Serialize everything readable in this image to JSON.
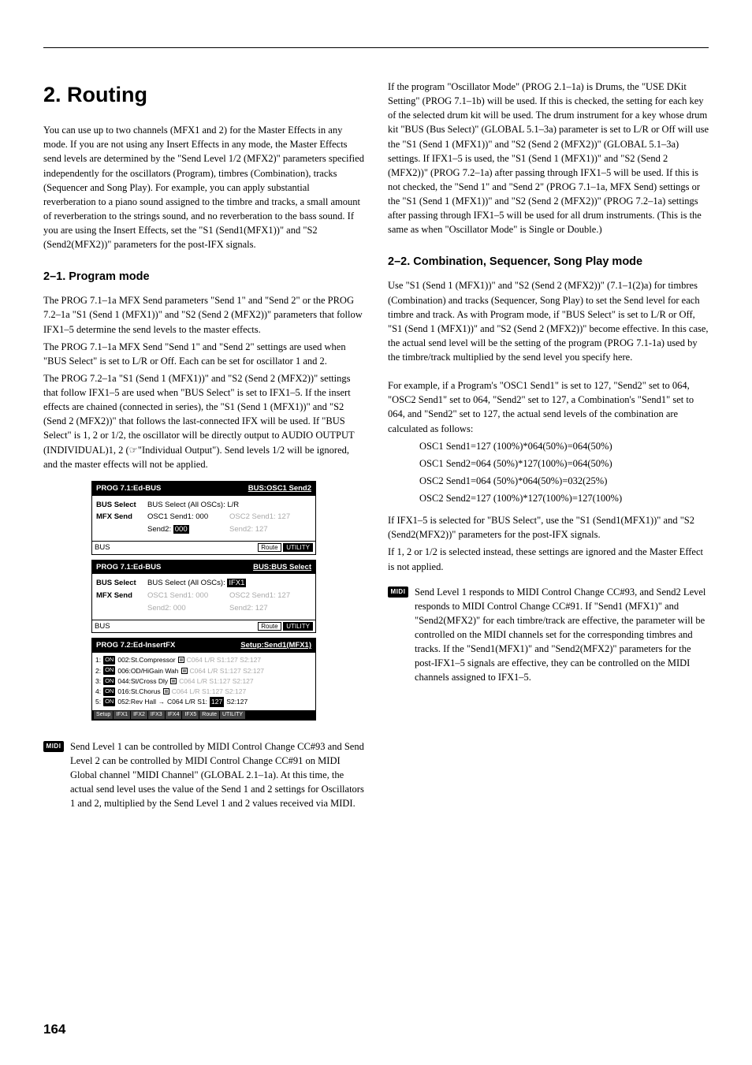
{
  "pageNumber": "164",
  "heading": "2. Routing",
  "intro": "You can use up to two channels (MFX1 and 2) for the Master Effects in any mode. If you are not using any Insert Effects in any mode, the Master Effects send levels are determined by the \"Send Level 1/2 (MFX2)\" parameters specified independently for the oscillators (Program), timbres (Combination), tracks (Sequencer and Song Play). For example, you can apply substantial reverberation to a piano sound assigned to the timbre and tracks, a small amount of reverberation to the strings sound, and no reverberation to the bass sound. If you are using the Insert Effects, set the \"S1 (Send1(MFX1))\" and \"S2 (Send2(MFX2))\" parameters for the post-IFX signals.",
  "sec21": {
    "title": "2–1. Program mode",
    "p1": "The PROG 7.1–1a MFX Send parameters \"Send 1\" and \"Send 2\" or the PROG 7.2–1a \"S1 (Send 1 (MFX1))\" and \"S2 (Send 2 (MFX2))\" parameters that follow IFX1–5 determine the send levels to the master effects.",
    "p2": "The PROG 7.1–1a MFX Send \"Send 1\" and \"Send 2\" settings are used when \"BUS Select\" is set to L/R or Off. Each can be set for oscillator 1 and 2.",
    "p3": "The PROG 7.2–1a \"S1 (Send 1 (MFX1))\" and \"S2 (Send 2 (MFX2))\" settings that follow IFX1–5 are used when \"BUS Select\" is set to IFX1–5. If the insert effects are chained (connected in series), the \"S1 (Send 1 (MFX1))\" and \"S2 (Send 2 (MFX2))\" that follows the last-connected IFX will be used. If \"BUS Select\" is 1, 2 or 1/2, the oscillator will be directly output to AUDIO OUTPUT (INDIVIDUAL)1, 2 (☞\"Individual Output\"). Send levels 1/2 will be ignored, and the master effects will not be applied."
  },
  "lcd1": {
    "title_l": "PROG 7.1:Ed-BUS",
    "title_r": "BUS:OSC1 Send2",
    "bus_select_lbl": "BUS Select",
    "bus_select_val": "BUS Select (All OSCs): L/R",
    "mfx_lbl": "MFX Send",
    "osc1send1": "OSC1 Send1: 000",
    "osc2send1": "OSC2 Send1: 127",
    "send2": "Send2:",
    "send2_val": "000",
    "send2_r": "Send2: 127",
    "bus_tab": "BUS",
    "route": "Route",
    "utility": "UTILITY"
  },
  "lcd2": {
    "title_l": "PROG 7.1:Ed-BUS",
    "title_r": "BUS:BUS Select",
    "bus_select_val": "BUS Select (All OSCs):",
    "bus_sel_hl": "IFX1",
    "osc1send1": "OSC1 Send1: 000",
    "osc2send1": "OSC2 Send1: 127",
    "send2": "Send2: 000",
    "send2_r": "Send2: 127"
  },
  "lcd3": {
    "title_l": "PROG 7.2:Ed-InsertFX",
    "title_r": "Setup:Send1(MFX1)",
    "r1a": "002:St.Compressor",
    "r1b": "C064 L/R S1:127 S2:127",
    "r2a": "006:OD/HiGain Wah",
    "r2b": "C064 L/R S1:127 S2:127",
    "r3a": "044:St/Cross Dly",
    "r3b": "C064 L/R S1:127 S2:127",
    "r4a": "016:St.Chorus",
    "r4b": "C064 L/R S1:127 S2:127",
    "r5a": "052:Rev Hall",
    "r5b1": "C064 L/R S1:",
    "r5b_hl": "127",
    "r5b2": "S2:127",
    "tabs": [
      "Setup",
      "IFX1",
      "IFX2",
      "IFX3",
      "IFX4",
      "IFX5",
      "Route",
      "UTILITY"
    ]
  },
  "midiLeft": {
    "icon": "MIDI",
    "text": "Send Level 1 can be controlled by MIDI Control Change CC#93 and Send Level 2 can be controlled by MIDI Control Change CC#91 on MIDI Global channel \"MIDI Channel\" (GLOBAL 2.1–1a). At this time, the actual send level uses the value of the Send 1 and 2 settings for Oscillators 1 and 2, multiplied by the Send Level 1 and 2 values received via MIDI."
  },
  "rightTop": "If the program \"Oscillator Mode\" (PROG 2.1–1a) is Drums, the \"USE DKit Setting\" (PROG 7.1–1b) will be used. If this is checked, the setting for each key of the selected drum kit will be used. The drum instrument for a key whose drum kit \"BUS (Bus Select)\" (GLOBAL 5.1–3a) parameter is set to L/R or Off will use the \"S1 (Send 1 (MFX1))\" and \"S2 (Send 2 (MFX2))\" (GLOBAL 5.1–3a) settings. If IFX1–5 is used, the \"S1 (Send 1 (MFX1))\" and \"S2 (Send 2 (MFX2))\" (PROG 7.2–1a) after passing through IFX1–5 will be used. If this is not checked, the \"Send 1\" and \"Send 2\" (PROG 7.1–1a, MFX Send) settings or the \"S1 (Send 1 (MFX1))\" and \"S2 (Send 2 (MFX2))\" (PROG 7.2–1a) settings after passing through IFX1–5 will be used for all drum instruments. (This is the same as when \"Oscillator Mode\" is Single or Double.)",
  "sec22": {
    "title": "2–2. Combination, Sequencer, Song Play mode",
    "p1": "Use \"S1 (Send 1 (MFX1))\" and \"S2 (Send 2 (MFX2))\" (7.1–1(2)a) for timbres (Combination) and tracks (Sequencer, Song Play) to set the Send level for each timbre and track. As with Program mode, if \"BUS Select\" is set to L/R or Off, \"S1 (Send 1 (MFX1))\" and \"S2 (Send 2 (MFX2))\" become effective. In this case, the actual send level will be the setting of the program (PROG 7.1-1a) used by the timbre/track multiplied by the send level you specify here.",
    "p2": "For example, if a Program's \"OSC1 Send1\" is set to 127, \"Send2\" set to 064, \"OSC2 Send1\" set to 064, \"Send2\" set to 127, a Combination's \"Send1\" set to 064, and \"Send2\" set to 127, the actual send levels of the combination are calculated as follows:",
    "calc": [
      "OSC1 Send1=127 (100%)*064(50%)=064(50%)",
      "OSC1 Send2=064 (50%)*127(100%)=064(50%)",
      "OSC2 Send1=064 (50%)*064(50%)=032(25%)",
      "OSC2 Send2=127 (100%)*127(100%)=127(100%)"
    ],
    "p3": "If IFX1–5 is selected for \"BUS Select\", use the \"S1 (Send1(MFX1))\" and \"S2 (Send2(MFX2))\" parameters for the post-IFX signals.",
    "p4": "If 1, 2 or 1/2 is selected instead, these settings are ignored and the Master Effect is not applied."
  },
  "midiRight": {
    "icon": "MIDI",
    "text": "Send Level 1 responds to MIDI Control Change CC#93, and Send2 Level responds to MIDI Control Change CC#91. If \"Send1 (MFX1)\" and \"Send2(MFX2)\" for each timbre/track are effective, the parameter will be controlled on the MIDI channels set for the corresponding timbres and tracks. If the \"Send1(MFX1)\" and \"Send2(MFX2)\" parameters for the post-IFX1–5 signals are effective, they can be controlled on the MIDI channels assigned to IFX1–5."
  }
}
